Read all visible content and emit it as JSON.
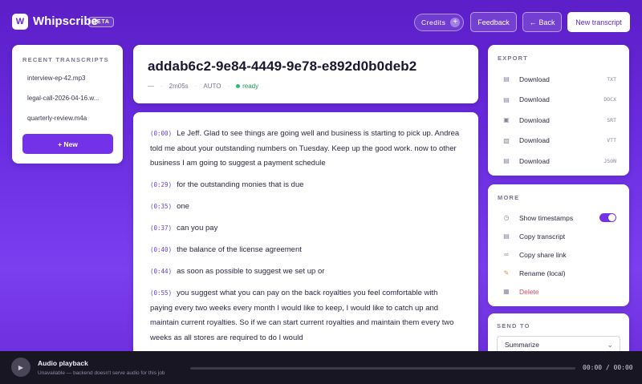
{
  "header": {
    "logo_letter": "W",
    "brand": "Whipscribe",
    "badge": "BETA",
    "credits_label": "Credits",
    "credits_plus": "+",
    "feedback_label": "Feedback",
    "back_label": "Back",
    "back_arrow": "←",
    "new_transcript_label": "New transcript"
  },
  "sidebar": {
    "heading": "RECENT TRANSCRIPTS",
    "items": [
      {
        "label": "interview-ep-42.mp3"
      },
      {
        "label": "legal-call-2026-04-16.w..."
      },
      {
        "label": "quarterly-review.m4a"
      }
    ],
    "new_button": "+ New"
  },
  "transcript": {
    "title": "addab6c2-9e84-4449-9e78-e892d0b0deb2",
    "meta_dash": "—",
    "duration": "2m05s",
    "language": "AUTO",
    "status": "ready",
    "segments": [
      {
        "time": "(0:00)",
        "text": "Le Jeff. Glad to see things are going well and business is starting to pick up. Andrea told me about your outstanding numbers on Tuesday. Keep up the good work. now to other business I am going to suggest a payment schedule"
      },
      {
        "time": "(0:29)",
        "text": "for the outstanding monies that is due"
      },
      {
        "time": "(0:35)",
        "text": "one"
      },
      {
        "time": "(0:37)",
        "text": "can you pay"
      },
      {
        "time": "(0:40)",
        "text": "the balance of the license agreement"
      },
      {
        "time": "(0:44)",
        "text": "as soon as possible to suggest we set up or"
      },
      {
        "time": "(0:55)",
        "text": "you suggest what you can pay on the back royalties you feel comfortable with paying every two weeks every month I would like to keep, I would like to catch up and maintain current royalties. So if we can start current royalties and maintain them every two weeks as all stores are required to do I would"
      }
    ]
  },
  "export": {
    "heading": "EXPORT",
    "items": [
      {
        "label": "Download",
        "ext": "TXT",
        "icon": "file-text-icon"
      },
      {
        "label": "Download",
        "ext": "DOCX",
        "icon": "document-icon"
      },
      {
        "label": "Download",
        "ext": "SRT",
        "icon": "clapperboard-icon"
      },
      {
        "label": "Download",
        "ext": "VTT",
        "icon": "film-icon"
      },
      {
        "label": "Download",
        "ext": "JSON",
        "icon": "file-code-icon"
      }
    ]
  },
  "more": {
    "heading": "MORE",
    "show_timestamps": "Show timestamps",
    "show_timestamps_on": true,
    "copy_transcript": "Copy transcript",
    "copy_share_link": "Copy share link",
    "rename": "Rename (local)",
    "delete": "Delete"
  },
  "send_to": {
    "heading": "SEND TO",
    "selected": "Summarize"
  },
  "audio": {
    "title": "Audio playback",
    "subtitle": "Unavailable — backend doesn't serve audio for this job",
    "time": "00:00 / 00:00"
  },
  "colors": {
    "accent": "#7332e8",
    "ready": "#22c06e",
    "danger": "#e24a5c"
  }
}
